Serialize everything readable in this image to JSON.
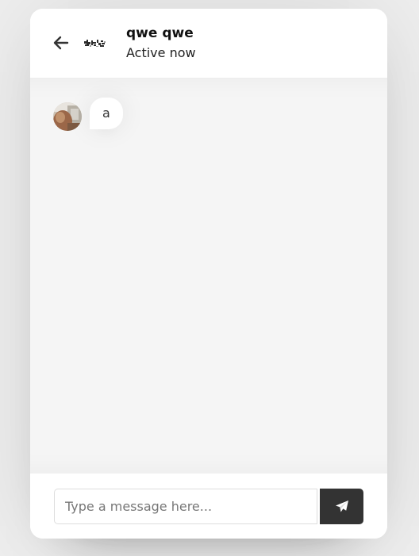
{
  "header": {
    "name": "qwe qwe",
    "status": "Active now",
    "back_icon": "arrow-left-icon"
  },
  "messages": [
    {
      "direction": "incoming",
      "text": "a"
    }
  ],
  "composer": {
    "placeholder": "Type a message here...",
    "value": "",
    "send_icon": "paper-plane-icon"
  },
  "colors": {
    "page_background": "#efefef",
    "card_background": "#ffffff",
    "chat_background": "#f5f5f5",
    "send_button": "#333333",
    "input_border": "#dddddd"
  }
}
